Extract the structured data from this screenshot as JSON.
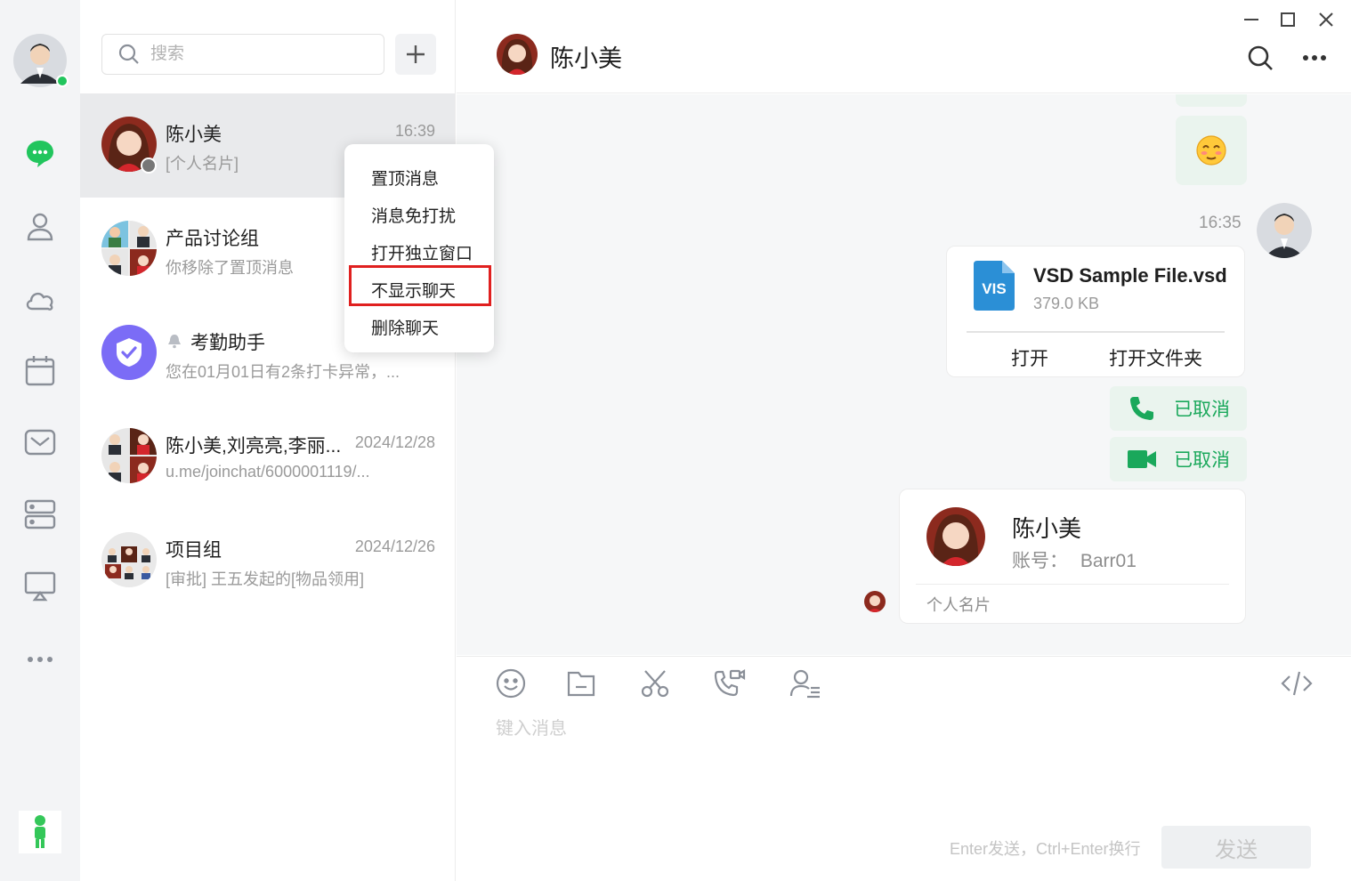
{
  "colors": {
    "accent_green": "#21c55d",
    "call_green": "#1aa85b",
    "highlight_red": "#e0201f",
    "purple": "#7b6cf6"
  },
  "rail": {
    "icons": [
      "chat-icon",
      "contacts-icon",
      "cloud-icon",
      "calendar-icon",
      "mail-icon",
      "server-icon",
      "screen-share-icon",
      "more-icon"
    ]
  },
  "search": {
    "placeholder": "搜索"
  },
  "conversations": [
    {
      "name": "陈小美",
      "time": "16:39",
      "preview": "[个人名片]"
    },
    {
      "name": "产品讨论组",
      "time": "",
      "preview": "你移除了置顶消息"
    },
    {
      "name": "考勤助手",
      "time": "",
      "preview": "您在01月01日有2条打卡异常，..."
    },
    {
      "name": "陈小美,刘亮亮,李丽...",
      "time": "2024/12/28",
      "preview": "u.me/joinchat/6000001119/..."
    },
    {
      "name": "项目组",
      "time": "2024/12/26",
      "preview": "[审批] 王五发起的[物品领用]"
    }
  ],
  "context_menu": [
    "置顶消息",
    "消息免打扰",
    "打开独立窗口",
    "不显示聊天",
    "删除聊天"
  ],
  "chat": {
    "title": "陈小美",
    "time_label": "16:35",
    "file": {
      "name": "VSD Sample File.vsd",
      "size": "379.0 KB",
      "badge": "VIS",
      "open": "打开",
      "open_folder": "打开文件夹"
    },
    "voice_call": "已取消",
    "video_call": "已取消",
    "contact_card": {
      "name": "陈小美",
      "account_label": "账号：",
      "account": "Barr01",
      "footer": "个人名片"
    }
  },
  "composer": {
    "placeholder": "键入消息",
    "hint": "Enter发送，Ctrl+Enter换行",
    "send": "发送"
  }
}
